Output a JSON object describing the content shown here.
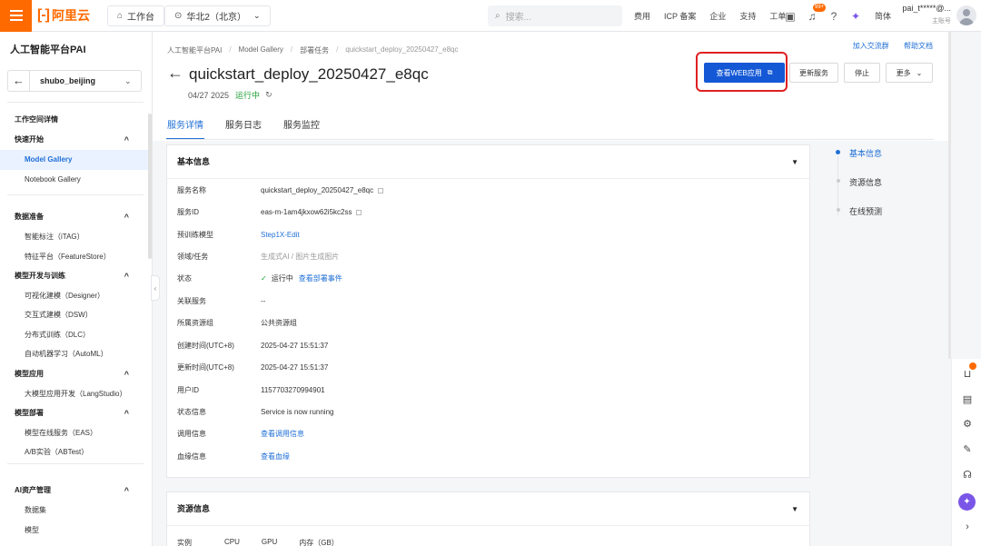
{
  "topbar": {
    "logo_text": "阿里云",
    "logo_mark": "[-]",
    "workbench": "工作台",
    "region": "华北2（北京）",
    "search_placeholder": "搜索...",
    "links": [
      "费用",
      "ICP 备案",
      "企业",
      "支持",
      "工单"
    ],
    "notify_badge": "99+",
    "lang": "简体",
    "account_name": "pai_t*****@...",
    "account_role": "主账号",
    "accent_color": "#ff6a00"
  },
  "sidebar": {
    "title": "人工智能平台PAI",
    "workspace": "shubo_beijing",
    "items": [
      {
        "label": "工作空间详情",
        "kind": "sec"
      },
      {
        "label": "快速开始",
        "kind": "sec",
        "chevron": "^"
      },
      {
        "label": "Model Gallery",
        "kind": "sub",
        "active": true
      },
      {
        "label": "Notebook Gallery",
        "kind": "sub"
      },
      {
        "label": "数据准备",
        "kind": "sec",
        "chevron": "^"
      },
      {
        "label": "智能标注（iTAG）",
        "kind": "sub"
      },
      {
        "label": "特征平台（FeatureStore）",
        "kind": "sub"
      },
      {
        "label": "模型开发与训练",
        "kind": "sec",
        "chevron": "^"
      },
      {
        "label": "可视化建模（Designer）",
        "kind": "sub"
      },
      {
        "label": "交互式建模（DSW）",
        "kind": "sub"
      },
      {
        "label": "分布式训练（DLC）",
        "kind": "sub"
      },
      {
        "label": "自动机器学习（AutoML）",
        "kind": "sub"
      },
      {
        "label": "模型应用",
        "kind": "sec",
        "chevron": "^"
      },
      {
        "label": "大模型应用开发（LangStudio）",
        "kind": "sub"
      },
      {
        "label": "模型部署",
        "kind": "sec",
        "chevron": "^"
      },
      {
        "label": "模型在线服务（EAS）",
        "kind": "sub"
      },
      {
        "label": "A/B实验（ABTest）",
        "kind": "sub"
      },
      {
        "label": "AI资产管理",
        "kind": "sec",
        "chevron": "^"
      },
      {
        "label": "数据集",
        "kind": "sub"
      },
      {
        "label": "模型",
        "kind": "sub"
      }
    ]
  },
  "breadcrumb": [
    "人工智能平台PAI",
    "Model Gallery",
    "部署任务",
    "quickstart_deploy_20250427_e8qc"
  ],
  "header": {
    "title": "quickstart_deploy_20250427_e8qc",
    "date": "04/27 2025",
    "status": "运行中",
    "link_group": "加入交流群",
    "link_docs": "帮助文档",
    "btn_view_web": "查看WEB应用",
    "btn_update": "更新服务",
    "btn_stop": "停止",
    "btn_more": "更多"
  },
  "tabs": [
    "服务详情",
    "服务日志",
    "服务监控"
  ],
  "basic_info": {
    "title": "基本信息",
    "rows": [
      {
        "label": "服务名称",
        "value": "quickstart_deploy_20250427_e8qc"
      },
      {
        "label": "服务ID",
        "value": "eas-m-1am4jkxow62i5kc2ss"
      },
      {
        "label": "预训练模型",
        "value": "Step1X-Edit"
      },
      {
        "label": "领域/任务",
        "value": "生成式AI / 图片生成图片"
      },
      {
        "label": "状态",
        "value": "运行中",
        "extra": "查看部署事件"
      },
      {
        "label": "关联服务",
        "value": "--"
      },
      {
        "label": "所属资源组",
        "value": "公共资源组"
      },
      {
        "label": "创建时间(UTC+8)",
        "value": "2025-04-27 15:51:37"
      },
      {
        "label": "更新时间(UTC+8)",
        "value": "2025-04-27 15:51:37"
      },
      {
        "label": "用户ID",
        "value": "1157703270994901"
      },
      {
        "label": "状态信息",
        "value": "Service is now running"
      },
      {
        "label": "调用信息",
        "value": "查看调用信息"
      },
      {
        "label": "血缘信息",
        "value": "查看血缘"
      }
    ]
  },
  "resource_info": {
    "title": "资源信息",
    "columns": [
      "实例",
      "CPU",
      "GPU",
      "内存（GB）"
    ]
  },
  "anchors": [
    "基本信息",
    "资源信息",
    "在线预测"
  ]
}
